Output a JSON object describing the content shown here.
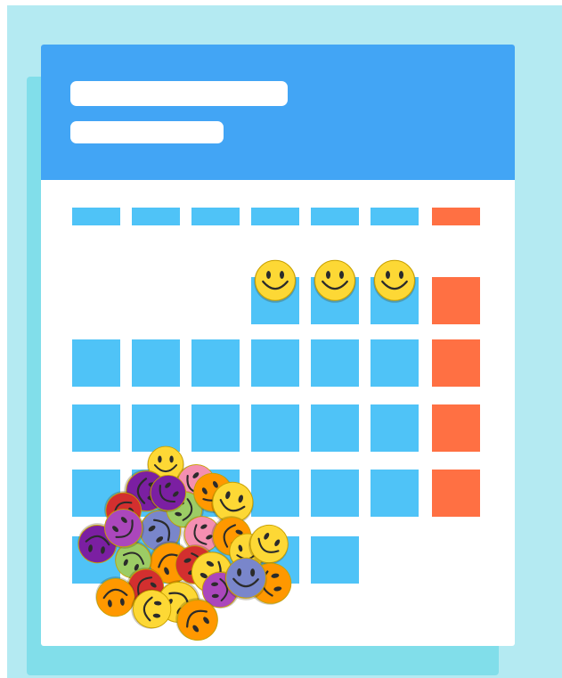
{
  "calendar": {
    "colors": {
      "header": "#42a5f5",
      "weekday_cell": "#4fc3f7",
      "weekend_cell": "#ff7043",
      "page": "#b4eaf2",
      "card_shadow": "#81deea"
    },
    "day_header_count": 7,
    "weeks": [
      {
        "filled_cols": [
          3,
          4,
          5,
          6
        ]
      },
      {
        "filled_cols": [
          0,
          1,
          2,
          3,
          4,
          5,
          6
        ]
      },
      {
        "filled_cols": [
          0,
          1,
          2,
          3,
          4,
          5,
          6
        ]
      },
      {
        "filled_cols": [
          0,
          1,
          2,
          3,
          4,
          5,
          6
        ]
      },
      {
        "filled_cols": [
          0,
          1,
          2,
          3,
          4
        ]
      }
    ],
    "smiley_marked_days": [
      {
        "week": 0,
        "col": 3
      },
      {
        "week": 0,
        "col": 4
      },
      {
        "week": 0,
        "col": 5
      }
    ]
  },
  "sticker_pile": {
    "icon": "smiley-face-sticker",
    "colors": [
      "#fdd835",
      "#ff9800",
      "#7b1fa2",
      "#f48fb1",
      "#9ccc65",
      "#7986cb",
      "#d32f2f",
      "#ab47bc"
    ]
  }
}
